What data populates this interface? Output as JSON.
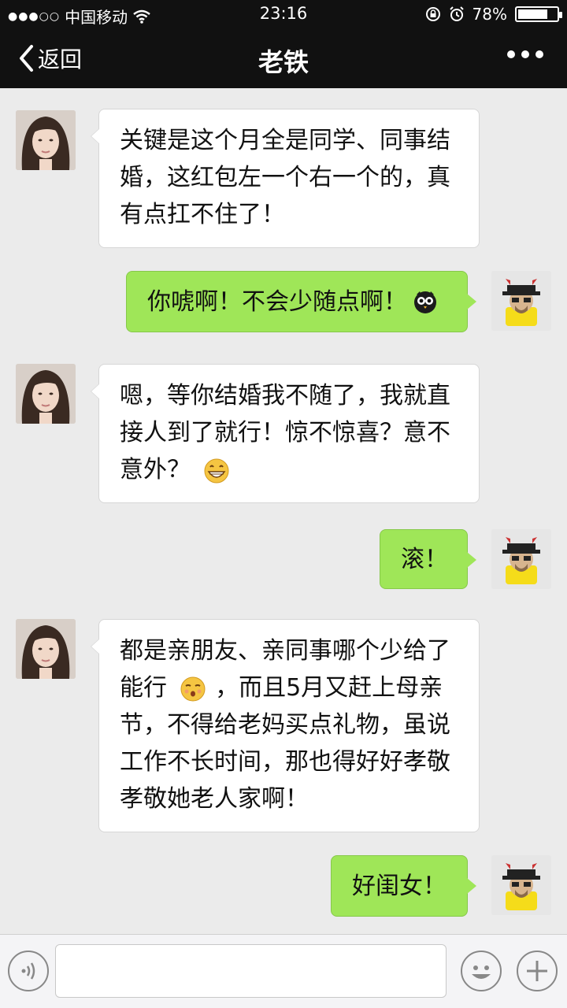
{
  "status_bar": {
    "carrier": "中国移动",
    "time": "23:16",
    "battery": "78%",
    "battery_level": 0.78
  },
  "nav": {
    "back_label": "返回",
    "title": "老铁"
  },
  "messages": [
    {
      "side": "left",
      "lines": [
        "关键是这个月全是同学、同事结",
        "婚，这红包左一个右一个的，真",
        "有点扛不住了！"
      ]
    },
    {
      "side": "right",
      "text": "你唬啊！不会少随点啊！",
      "emoji": "owl-emoji"
    },
    {
      "side": "left",
      "lines": [
        "嗯，等你结婚我不随了，我就直",
        "接人到了就行！惊不惊喜？意不",
        "意外？"
      ],
      "emoji": "grin-emoji"
    },
    {
      "side": "right",
      "text": "滚！"
    },
    {
      "side": "left",
      "lines": [
        "都是亲朋友、亲同事哪个少给了",
        "能行",
        "，而且5月又赶上母亲",
        "节，不得给老妈买点礼物，虽说",
        "工作不长时间，那也得好好孝敬",
        "孝敬她老人家啊！"
      ],
      "emoji": "smirk-emoji"
    },
    {
      "side": "right",
      "text": "好闺女！"
    }
  ],
  "icons": {
    "signal": "signal-dots-icon",
    "wifi": "wifi-icon",
    "lock_rotation": "rotation-lock-icon",
    "alarm": "alarm-icon",
    "battery": "battery-icon",
    "back": "chevron-left-icon",
    "more": "more-dots-icon",
    "voice": "voice-icon",
    "emoji": "emoji-icon",
    "plus": "plus-icon"
  },
  "colors": {
    "bar_bg": "#111111",
    "chat_bg": "#ebebeb",
    "bubble_self": "#9fe658",
    "bubble_other": "#ffffff"
  }
}
